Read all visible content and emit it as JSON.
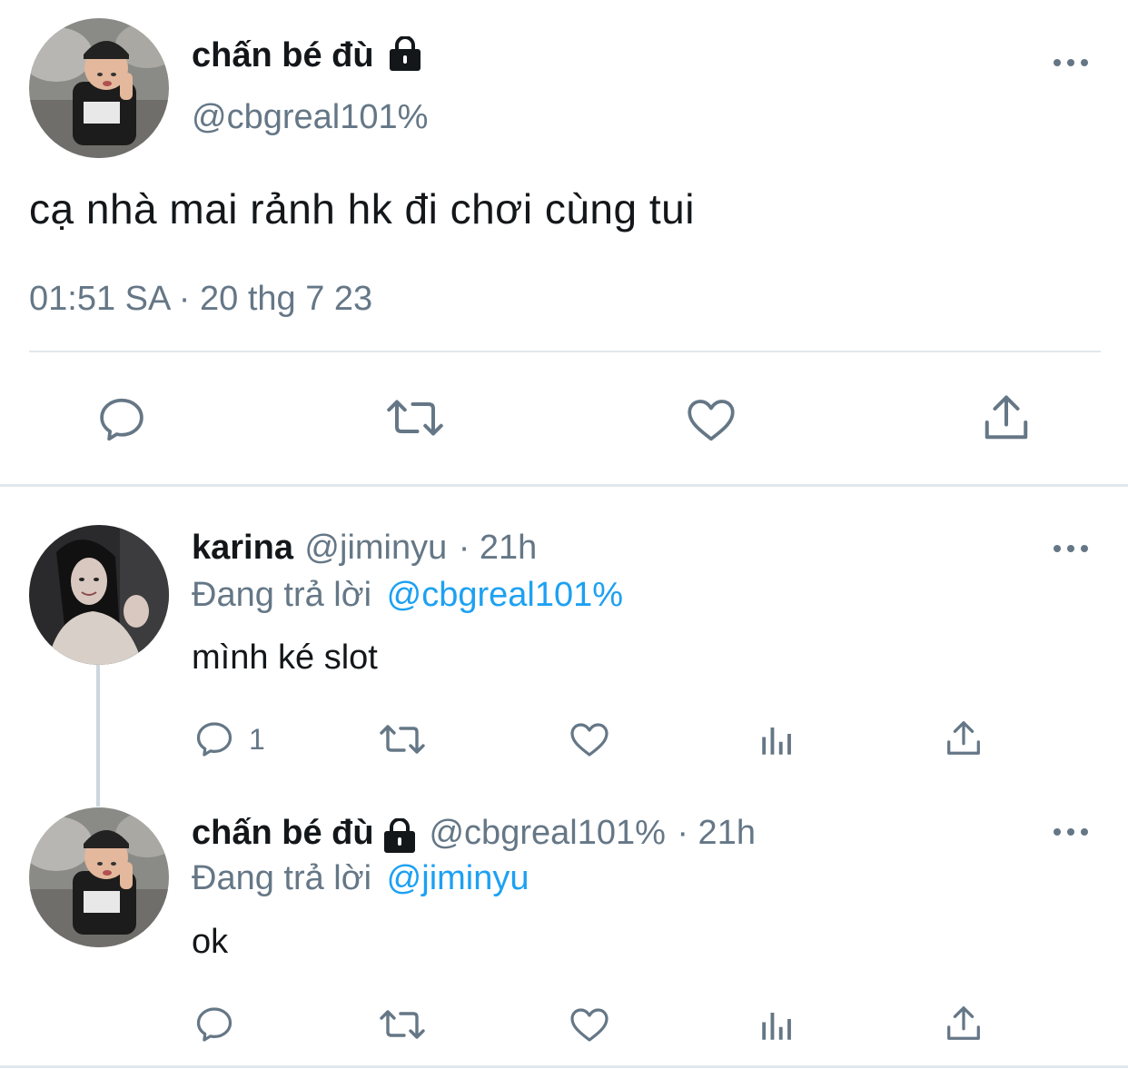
{
  "main_tweet": {
    "author_name": "chấn bé đù",
    "author_handle": "@cbgreal101%",
    "text": "cạ nhà mai rảnh hk đi chơi cùng tui",
    "timestamp": "01:51 SA · 20 thg 7 23"
  },
  "replies": [
    {
      "author_name": "karina",
      "author_handle": "@jiminyu",
      "time": "· 21h",
      "replying_label": "Đang trả lời",
      "replying_to": "@cbgreal101%",
      "text": "mình ké slot",
      "reply_count": "1"
    },
    {
      "author_name": "chấn bé đù",
      "author_handle": "@cbgreal101%",
      "time": "· 21h",
      "replying_label": "Đang trả lời",
      "replying_to": "@jiminyu",
      "text": "ok",
      "reply_count": ""
    }
  ],
  "icons": {
    "reply": "reply-icon",
    "retweet": "retweet-icon",
    "like": "heart-icon",
    "analytics": "analytics-icon",
    "share": "share-icon",
    "more": "more-icon",
    "lock": "lock-icon"
  },
  "colors": {
    "text": "#14171a",
    "secondary": "#657786",
    "link": "#1da1f2",
    "divider": "#e1e8ed"
  }
}
